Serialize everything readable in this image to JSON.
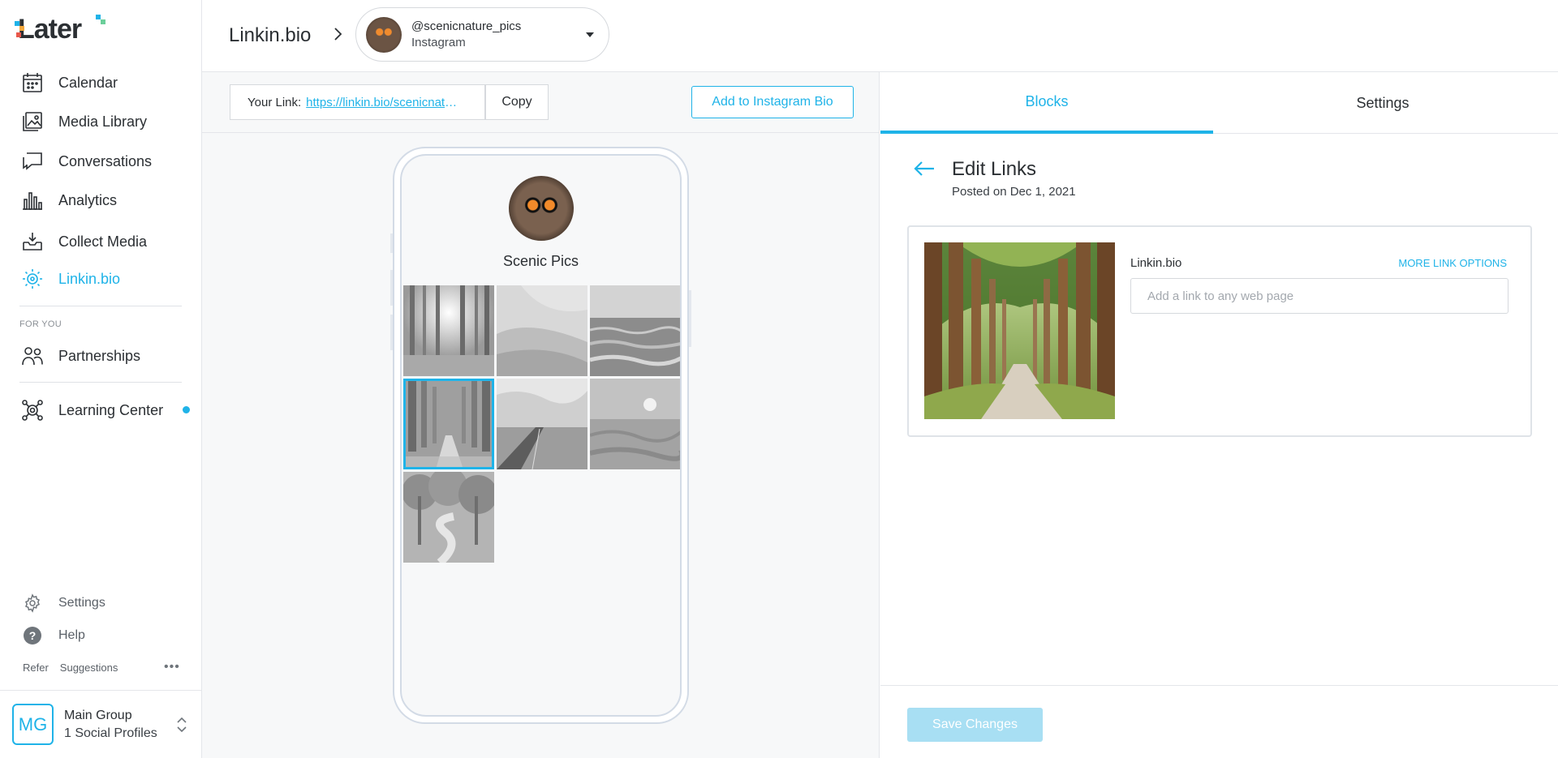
{
  "sidebar": {
    "logo": "Later",
    "nav": [
      {
        "label": "Calendar",
        "icon": "calendar-icon"
      },
      {
        "label": "Media Library",
        "icon": "media-library-icon"
      },
      {
        "label": "Conversations",
        "icon": "conversations-icon"
      },
      {
        "label": "Analytics",
        "icon": "analytics-icon"
      },
      {
        "label": "Collect Media",
        "icon": "collect-media-icon"
      },
      {
        "label": "Linkin.bio",
        "icon": "linkin-bio-icon",
        "active": true
      }
    ],
    "section_label": "FOR YOU",
    "partnerships": "Partnerships",
    "learning_center": "Learning Center",
    "settings": "Settings",
    "help": "Help",
    "refer": "Refer",
    "suggestions": "Suggestions",
    "more": "•••",
    "group": {
      "initials": "MG",
      "name": "Main Group",
      "profiles": "1 Social Profiles"
    },
    "accent": "#1fb3e8"
  },
  "header": {
    "title": "Linkin.bio",
    "profile": {
      "handle": "@scenicnature_pics",
      "network": "Instagram"
    }
  },
  "link_bar": {
    "label": "Your Link:",
    "url": "https://linkin.bio/scenicnature_pics",
    "copy": "Copy",
    "add_button": "Add to Instagram Bio"
  },
  "preview": {
    "name": "Scenic Pics",
    "tiles": [
      "forest-sunlight",
      "sand-dunes",
      "ocean-waves",
      "tree-lined-path",
      "desert-road",
      "sea-sunset",
      "winding-forest-path"
    ],
    "selected_tile": 3
  },
  "right": {
    "tabs": [
      {
        "label": "Blocks",
        "active": true
      },
      {
        "label": "Settings",
        "active": false
      }
    ],
    "title": "Edit Links",
    "posted": "Posted on Dec 1, 2021",
    "card_label": "Linkin.bio",
    "more_options": "MORE LINK OPTIONS",
    "input_placeholder": "Add a link to any web page",
    "input_value": "",
    "save": "Save Changes"
  }
}
